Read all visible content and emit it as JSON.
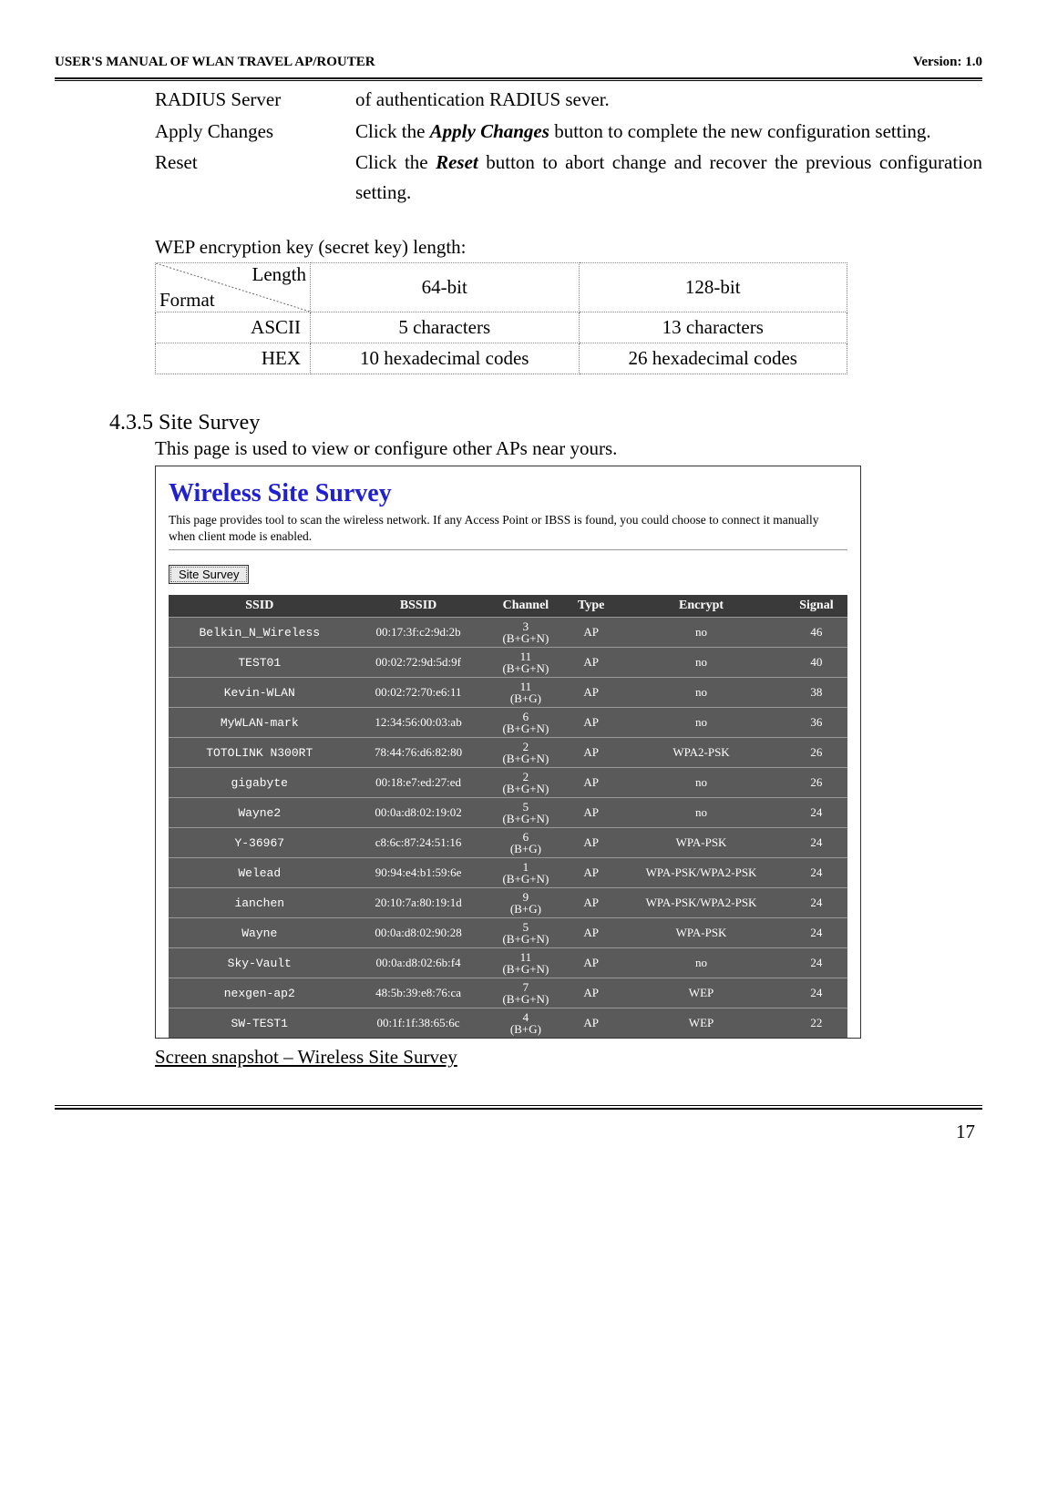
{
  "header": {
    "left": "USER'S MANUAL OF WLAN TRAVEL AP/ROUTER",
    "right": "Version: 1.0"
  },
  "definitions": [
    {
      "label": "RADIUS Server",
      "desc_plain": "of authentication RADIUS sever."
    },
    {
      "label": "Apply Changes",
      "desc_html": "Click the <em class='b'>Apply Changes</em> button to complete the new configuration setting."
    },
    {
      "label": "Reset",
      "desc_html": "Click the <em class='b'>Reset</em> button to abort change and recover the previous configuration setting."
    }
  ],
  "wep": {
    "caption": "WEP encryption key (secret key) length:",
    "corner": {
      "length": "Length",
      "format": "Format"
    },
    "cols": [
      "64-bit",
      "128-bit"
    ],
    "rows": [
      {
        "label": "ASCII",
        "cells": [
          "5 characters",
          "13 characters"
        ]
      },
      {
        "label": "HEX",
        "cells": [
          "10 hexadecimal codes",
          "26 hexadecimal codes"
        ]
      }
    ]
  },
  "section": {
    "num_title": "4.3.5  Site Survey",
    "intro": "This page is used to view or configure other APs near yours."
  },
  "survey": {
    "title": "Wireless Site Survey",
    "desc": "This page provides tool to scan the wireless network. If any Access Point or IBSS is found, you could choose to connect it manually when client mode is enabled.",
    "button": "Site Survey",
    "headers": [
      "SSID",
      "BSSID",
      "Channel",
      "Type",
      "Encrypt",
      "Signal"
    ],
    "rows": [
      {
        "ssid": "Belkin_N_Wireless",
        "bssid": "00:17:3f:c2:9d:2b",
        "channel": "3 (B+G+N)",
        "type": "AP",
        "encrypt": "no",
        "signal": "46"
      },
      {
        "ssid": "TEST01",
        "bssid": "00:02:72:9d:5d:9f",
        "channel": "11 (B+G+N)",
        "type": "AP",
        "encrypt": "no",
        "signal": "40"
      },
      {
        "ssid": "Kevin-WLAN",
        "bssid": "00:02:72:70:e6:11",
        "channel": "11 (B+G)",
        "type": "AP",
        "encrypt": "no",
        "signal": "38"
      },
      {
        "ssid": "MyWLAN-mark",
        "bssid": "12:34:56:00:03:ab",
        "channel": "6 (B+G+N)",
        "type": "AP",
        "encrypt": "no",
        "signal": "36"
      },
      {
        "ssid": "TOTOLINK N300RT",
        "bssid": "78:44:76:d6:82:80",
        "channel": "2 (B+G+N)",
        "type": "AP",
        "encrypt": "WPA2-PSK",
        "signal": "26"
      },
      {
        "ssid": "gigabyte",
        "bssid": "00:18:e7:ed:27:ed",
        "channel": "2 (B+G+N)",
        "type": "AP",
        "encrypt": "no",
        "signal": "26"
      },
      {
        "ssid": "Wayne2",
        "bssid": "00:0a:d8:02:19:02",
        "channel": "5 (B+G+N)",
        "type": "AP",
        "encrypt": "no",
        "signal": "24"
      },
      {
        "ssid": "Y-36967",
        "bssid": "c8:6c:87:24:51:16",
        "channel": "6 (B+G)",
        "type": "AP",
        "encrypt": "WPA-PSK",
        "signal": "24"
      },
      {
        "ssid": "Welead",
        "bssid": "90:94:e4:b1:59:6e",
        "channel": "1 (B+G+N)",
        "type": "AP",
        "encrypt": "WPA-PSK/WPA2-PSK",
        "signal": "24"
      },
      {
        "ssid": "ianchen",
        "bssid": "20:10:7a:80:19:1d",
        "channel": "9 (B+G)",
        "type": "AP",
        "encrypt": "WPA-PSK/WPA2-PSK",
        "signal": "24"
      },
      {
        "ssid": "Wayne",
        "bssid": "00:0a:d8:02:90:28",
        "channel": "5 (B+G+N)",
        "type": "AP",
        "encrypt": "WPA-PSK",
        "signal": "24"
      },
      {
        "ssid": "Sky-Vault",
        "bssid": "00:0a:d8:02:6b:f4",
        "channel": "11 (B+G+N)",
        "type": "AP",
        "encrypt": "no",
        "signal": "24"
      },
      {
        "ssid": "nexgen-ap2",
        "bssid": "48:5b:39:e8:76:ca",
        "channel": "7 (B+G+N)",
        "type": "AP",
        "encrypt": "WEP",
        "signal": "24"
      },
      {
        "ssid": "SW-TEST1",
        "bssid": "00:1f:1f:38:65:6c",
        "channel": "4 (B+G)",
        "type": "AP",
        "encrypt": "WEP",
        "signal": "22"
      }
    ]
  },
  "snapshot_caption": "Screen snapshot – Wireless Site Survey",
  "page_number": "17"
}
